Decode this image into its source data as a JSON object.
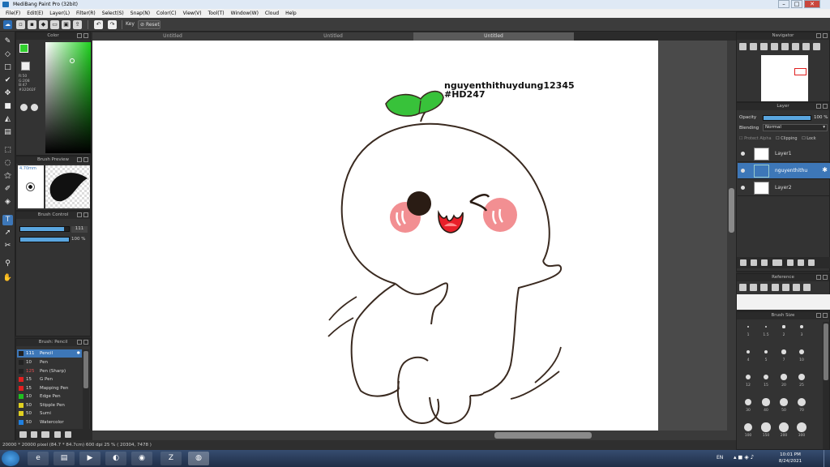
{
  "window": {
    "title": "MediBang Paint Pro (32bit)",
    "min": "–",
    "max": "□",
    "close": "✕"
  },
  "menu": [
    "File(F)",
    "Edit(E)",
    "Layer(L)",
    "Filter(R)",
    "Select(S)",
    "Snap(N)",
    "Color(C)",
    "View(V)",
    "Tool(T)",
    "Window(W)",
    "Cloud",
    "Help"
  ],
  "toolbar": {
    "key_label": "Key",
    "reset_label": "Reset",
    "undo": "↶",
    "redo": "↷"
  },
  "tabs": [
    "Untitled",
    "Untitled",
    "Untitled"
  ],
  "color_panel": {
    "title": "Color",
    "r": "R:50",
    "g": "G:208",
    "b": "B:47",
    "hex": "#32D02F",
    "primary_color": "#32d02f",
    "secondary_color": "#ffffff"
  },
  "brush_preview": {
    "title": "Brush Preview",
    "size": "4.70mm"
  },
  "brush_control": {
    "title": "Brush Control",
    "size_value": "111",
    "opacity_value": "100 %",
    "size_fraction": 0.9,
    "opacity_fraction": 1.0
  },
  "brush_list": {
    "title": "Brush: Pencil",
    "items": [
      {
        "size": "111",
        "name": "Pencil",
        "color": "#222222"
      },
      {
        "size": "10",
        "name": "Pen",
        "color": "#222222"
      },
      {
        "size": "125",
        "name": "Pen (Sharp)",
        "color": "#222222"
      },
      {
        "size": "15",
        "name": "G Pen",
        "color": "#e02020"
      },
      {
        "size": "15",
        "name": "Mapping Pen",
        "color": "#e02020"
      },
      {
        "size": "10",
        "name": "Edge Pen",
        "color": "#20c020"
      },
      {
        "size": "50",
        "name": "Stipple Pen",
        "color": "#e0d020"
      },
      {
        "size": "50",
        "name": "Sumi",
        "color": "#e0d020"
      },
      {
        "size": "50",
        "name": "Watercolor",
        "color": "#2080e0"
      }
    ]
  },
  "canvas_text": {
    "line1": "nguyenthithuydung12345",
    "line2": "#HD247"
  },
  "statusbar": "20000 * 20000 pixel  (84.7 * 84.7cm)  600 dpi  25 %  ( 20304, 7478 )",
  "navigator": {
    "title": "Navigator"
  },
  "layer_panel": {
    "title": "Layer",
    "opacity_label": "Opacity",
    "opacity_value": "100 %",
    "blending_label": "Blending",
    "blending_value": "Normal",
    "protect_alpha": "Protect Alpha",
    "clipping": "Clipping",
    "lock": "Lock",
    "layers": [
      "Layer1",
      "nguyenthithu",
      "Layer2"
    ]
  },
  "reference": {
    "title": "Reference"
  },
  "brush_size": {
    "title": "Brush Size",
    "labels": [
      "1",
      "1.5",
      "2",
      "3",
      "4",
      "5",
      "7",
      "10",
      "12",
      "15",
      "20",
      "25",
      "30",
      "40",
      "50",
      "70",
      "100",
      "150",
      "200",
      "300"
    ]
  },
  "taskbar": {
    "lang": "EN",
    "time": "10:01 PM",
    "date": "8/24/2021"
  }
}
